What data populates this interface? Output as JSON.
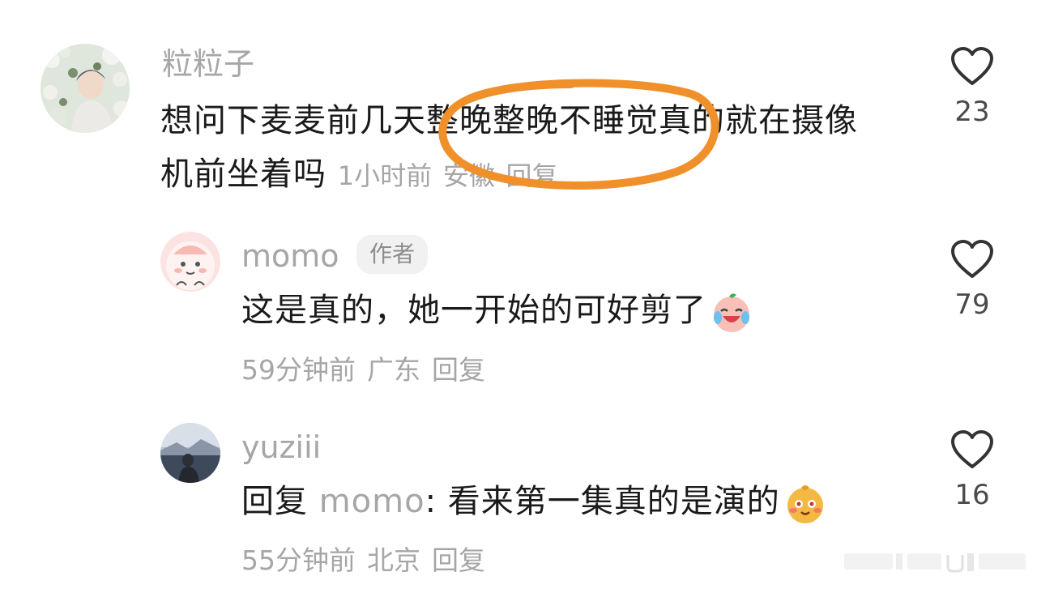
{
  "comments": [
    {
      "username": "粒粒子",
      "text": "想问下麦麦前几天整晚整晚不睡觉真的就在摄像机前坐着吗",
      "time": "1小时前",
      "location": "安徽",
      "reply_label": "回复",
      "likes": "23"
    },
    {
      "username": "momo",
      "badge": "作者",
      "text": "这是真的，她一开始的可好剪了",
      "emoji": "crying-laughing-emoji",
      "time": "59分钟前",
      "location": "广东",
      "reply_label": "回复",
      "likes": "79"
    },
    {
      "username": "yuziii",
      "reply_prefix": "回复",
      "reply_to": "momo",
      "text": "看来第一集真的是演的",
      "emoji": "smiling-blush-emoji",
      "time": "55分钟前",
      "location": "北京",
      "reply_label": "回复",
      "likes": "16"
    }
  ],
  "annotation": {
    "type": "orange-ellipse-highlight",
    "color": "#f0902a"
  },
  "icons": {
    "like": "heart-outline-icon"
  }
}
